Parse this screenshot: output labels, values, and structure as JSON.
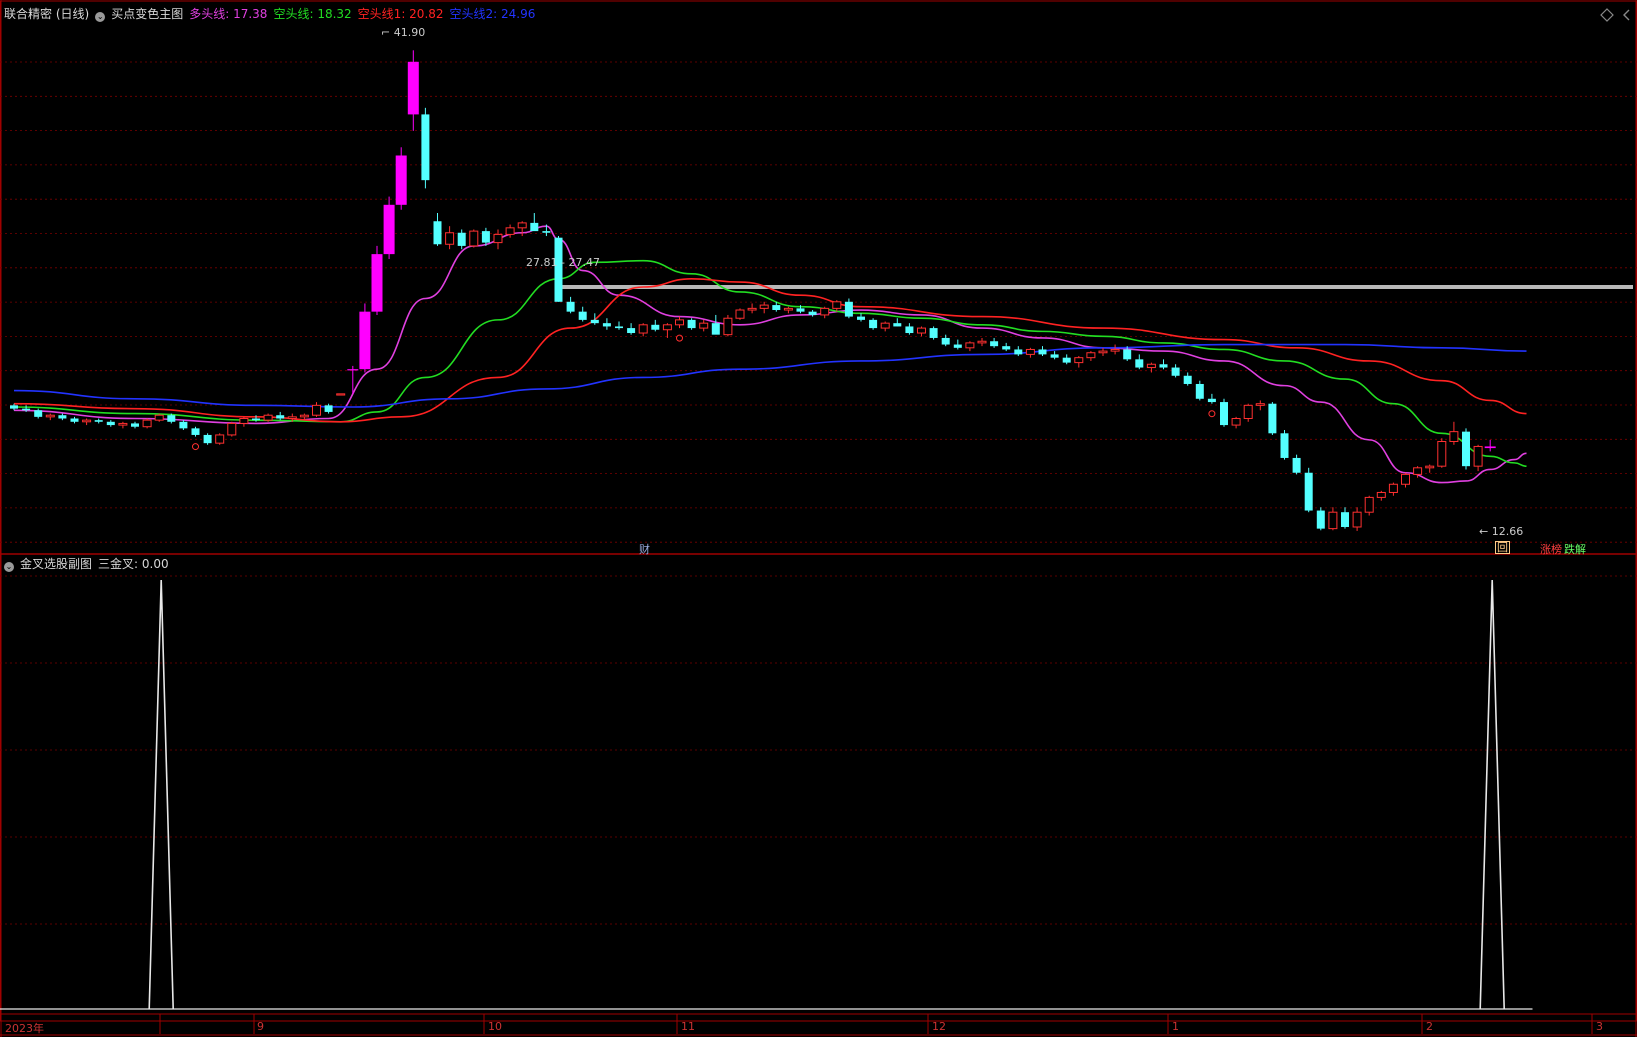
{
  "main_panel": {
    "title": "联合精密 (日线)",
    "indicator_name": "买点变色主图",
    "lines": [
      {
        "label": "多头线",
        "value": "17.38",
        "color": "#e040e0"
      },
      {
        "label": "空头线",
        "value": "18.32",
        "color": "#22dd22"
      },
      {
        "label": "空头线1",
        "value": "20.82",
        "color": "#ff2222"
      },
      {
        "label": "空头线2",
        "value": "24.96",
        "color": "#2233ff"
      }
    ],
    "annotations": {
      "high": "41.90",
      "low": "12.66",
      "range": "27.81 - 27.47",
      "tag_cai": "财",
      "tag_hui": "回",
      "tag_zhangbang": "涨榜",
      "tag_diejie": "跌解"
    }
  },
  "sub_panel": {
    "indicator_name": "金叉选股副图",
    "label": "三金叉",
    "value": "0.00"
  },
  "x_axis": {
    "labels": [
      "2023年",
      "9",
      "10",
      "11",
      "12",
      "1",
      "2",
      "3"
    ]
  },
  "colors": {
    "up": "#ff3030",
    "down": "#54ffff",
    "buy": "#ff00ff",
    "grid": "#7a0000",
    "border": "#a00000"
  },
  "chart_data": {
    "type": "candlestick",
    "price_range": [
      11.5,
      43.5
    ],
    "candles_ohlc": [
      [
        20.3,
        20.4,
        20.0,
        20.1
      ],
      [
        20.1,
        20.3,
        19.9,
        20.0
      ],
      [
        20.0,
        20.1,
        19.5,
        19.6
      ],
      [
        19.6,
        19.8,
        19.4,
        19.7
      ],
      [
        19.7,
        19.8,
        19.4,
        19.5
      ],
      [
        19.5,
        19.6,
        19.2,
        19.3
      ],
      [
        19.3,
        19.5,
        19.1,
        19.4
      ],
      [
        19.4,
        19.5,
        19.2,
        19.3
      ],
      [
        19.3,
        19.4,
        19.0,
        19.1
      ],
      [
        19.1,
        19.3,
        18.9,
        19.2
      ],
      [
        19.2,
        19.3,
        18.9,
        19.0
      ],
      [
        19.0,
        19.5,
        18.9,
        19.4
      ],
      [
        19.4,
        19.8,
        19.3,
        19.7
      ],
      [
        19.7,
        19.8,
        19.2,
        19.3
      ],
      [
        19.3,
        19.4,
        18.8,
        18.9
      ],
      [
        18.9,
        19.0,
        18.4,
        18.5
      ],
      [
        18.5,
        18.6,
        17.9,
        18.0
      ],
      [
        18.0,
        18.6,
        17.9,
        18.5
      ],
      [
        18.5,
        19.3,
        18.4,
        19.2
      ],
      [
        19.2,
        19.6,
        19.0,
        19.5
      ],
      [
        19.5,
        19.7,
        19.3,
        19.4
      ],
      [
        19.4,
        19.8,
        19.3,
        19.7
      ],
      [
        19.7,
        19.9,
        19.4,
        19.5
      ],
      [
        19.5,
        19.8,
        19.3,
        19.6
      ],
      [
        19.6,
        19.8,
        19.4,
        19.7
      ],
      [
        19.7,
        20.5,
        19.6,
        20.3
      ],
      [
        20.3,
        20.4,
        19.8,
        19.9
      ],
      [
        21.0,
        21.0,
        21.0,
        21.0
      ],
      [
        22.5,
        22.7,
        21.0,
        22.5
      ],
      [
        22.5,
        26.5,
        22.3,
        26.0
      ],
      [
        26.0,
        30.0,
        25.8,
        29.5
      ],
      [
        29.5,
        33.0,
        29.2,
        32.5
      ],
      [
        32.5,
        36.0,
        32.2,
        35.5
      ],
      [
        41.2,
        41.9,
        37.0,
        38.0
      ],
      [
        38.0,
        38.4,
        33.5,
        34.0
      ],
      [
        31.5,
        32.0,
        30.0,
        30.1
      ],
      [
        30.1,
        31.2,
        29.8,
        30.8
      ],
      [
        30.8,
        31.0,
        29.8,
        30.0
      ],
      [
        30.0,
        31.0,
        29.9,
        30.9
      ],
      [
        30.9,
        31.1,
        30.0,
        30.2
      ],
      [
        30.2,
        31.0,
        29.8,
        30.7
      ],
      [
        30.7,
        31.3,
        30.5,
        31.1
      ],
      [
        31.1,
        31.5,
        30.6,
        31.4
      ],
      [
        31.4,
        32.0,
        31.0,
        30.9
      ],
      [
        30.9,
        31.3,
        30.6,
        30.8
      ],
      [
        30.5,
        30.6,
        26.6,
        26.6
      ],
      [
        26.6,
        26.9,
        25.9,
        26.0
      ],
      [
        26.0,
        26.3,
        25.4,
        25.5
      ],
      [
        25.5,
        25.9,
        25.2,
        25.3
      ],
      [
        25.3,
        25.6,
        24.9,
        25.1
      ],
      [
        25.1,
        25.4,
        24.9,
        25.0
      ],
      [
        25.0,
        25.3,
        24.6,
        24.7
      ],
      [
        24.7,
        25.3,
        24.5,
        25.2
      ],
      [
        25.2,
        25.5,
        24.8,
        24.9
      ],
      [
        24.9,
        25.3,
        24.4,
        25.2
      ],
      [
        25.2,
        25.7,
        25.0,
        25.5
      ],
      [
        25.5,
        25.6,
        24.9,
        25.0
      ],
      [
        25.0,
        25.5,
        24.8,
        25.3
      ],
      [
        25.3,
        25.8,
        25.1,
        24.6
      ],
      [
        24.6,
        25.8,
        24.5,
        25.6
      ],
      [
        25.6,
        26.2,
        25.5,
        26.1
      ],
      [
        26.1,
        26.5,
        25.9,
        26.2
      ],
      [
        26.2,
        26.6,
        25.9,
        26.4
      ],
      [
        26.4,
        26.6,
        26.0,
        26.1
      ],
      [
        26.1,
        26.3,
        25.9,
        26.2
      ],
      [
        26.2,
        26.4,
        25.9,
        26.0
      ],
      [
        26.0,
        26.1,
        25.7,
        25.8
      ],
      [
        25.8,
        26.3,
        25.6,
        26.2
      ],
      [
        26.2,
        26.7,
        26.0,
        26.6
      ],
      [
        26.6,
        26.8,
        25.6,
        25.7
      ],
      [
        25.7,
        25.9,
        25.4,
        25.5
      ],
      [
        25.5,
        25.6,
        24.9,
        25.0
      ],
      [
        25.0,
        25.4,
        24.8,
        25.3
      ],
      [
        25.3,
        25.6,
        25.1,
        25.1
      ],
      [
        25.1,
        25.3,
        24.6,
        24.7
      ],
      [
        24.7,
        25.1,
        24.5,
        25.0
      ],
      [
        25.0,
        25.1,
        24.3,
        24.4
      ],
      [
        24.4,
        24.6,
        23.9,
        24.0
      ],
      [
        24.0,
        24.3,
        23.7,
        23.8
      ],
      [
        23.8,
        24.2,
        23.6,
        24.1
      ],
      [
        24.1,
        24.4,
        23.9,
        24.2
      ],
      [
        24.2,
        24.4,
        23.8,
        23.9
      ],
      [
        23.9,
        24.1,
        23.6,
        23.7
      ],
      [
        23.7,
        23.9,
        23.3,
        23.4
      ],
      [
        23.4,
        23.8,
        23.2,
        23.7
      ],
      [
        23.7,
        23.9,
        23.3,
        23.4
      ],
      [
        23.4,
        23.6,
        23.1,
        23.2
      ],
      [
        23.2,
        23.4,
        22.8,
        22.9
      ],
      [
        22.9,
        23.3,
        22.6,
        23.2
      ],
      [
        23.2,
        23.6,
        23.0,
        23.5
      ],
      [
        23.5,
        23.8,
        23.3,
        23.6
      ],
      [
        23.6,
        24.0,
        23.4,
        23.7
      ],
      [
        23.7,
        23.9,
        23.0,
        23.1
      ],
      [
        23.1,
        23.4,
        22.5,
        22.6
      ],
      [
        22.6,
        22.9,
        22.3,
        22.8
      ],
      [
        22.8,
        23.1,
        22.5,
        22.6
      ],
      [
        22.6,
        22.8,
        22.0,
        22.1
      ],
      [
        22.1,
        22.3,
        21.5,
        21.6
      ],
      [
        21.6,
        21.8,
        20.6,
        20.7
      ],
      [
        20.7,
        21.0,
        20.4,
        20.5
      ],
      [
        20.5,
        20.7,
        19.0,
        19.1
      ],
      [
        19.1,
        19.6,
        18.9,
        19.5
      ],
      [
        19.5,
        20.4,
        19.3,
        20.3
      ],
      [
        20.3,
        20.6,
        20.0,
        20.4
      ],
      [
        20.4,
        20.5,
        18.5,
        18.6
      ],
      [
        18.6,
        18.8,
        17.0,
        17.1
      ],
      [
        17.1,
        17.3,
        16.1,
        16.2
      ],
      [
        16.2,
        16.5,
        13.8,
        13.9
      ],
      [
        13.9,
        14.1,
        12.7,
        12.8
      ],
      [
        12.8,
        14.1,
        12.7,
        13.8
      ],
      [
        13.8,
        14.1,
        12.8,
        12.9
      ],
      [
        12.9,
        14.1,
        12.66,
        13.8
      ],
      [
        13.8,
        14.8,
        13.6,
        14.7
      ],
      [
        14.7,
        15.1,
        14.5,
        15.0
      ],
      [
        15.0,
        15.6,
        14.8,
        15.5
      ],
      [
        15.5,
        16.2,
        15.3,
        16.1
      ],
      [
        16.1,
        16.6,
        15.9,
        16.5
      ],
      [
        16.5,
        16.7,
        16.2,
        16.6
      ],
      [
        16.6,
        18.3,
        16.5,
        18.1
      ],
      [
        18.1,
        19.3,
        17.9,
        18.7
      ],
      [
        18.7,
        18.9,
        16.4,
        16.6
      ],
      [
        16.6,
        17.9,
        16.3,
        17.8
      ],
      [
        17.8,
        18.2,
        17.5,
        17.7
      ]
    ],
    "buy_signal_indices": [
      28,
      29,
      30,
      31,
      32,
      33,
      122
    ],
    "marker_indices": [
      15,
      55,
      99
    ],
    "hline_level": 27.5,
    "ma_lines": [
      {
        "name": "多头线",
        "color": "#e040e0",
        "points": [
          [
            0,
            20.0
          ],
          [
            10,
            19.5
          ],
          [
            20,
            19.2
          ],
          [
            26,
            19.5
          ],
          [
            30,
            22.5
          ],
          [
            34,
            26.8
          ],
          [
            38,
            30.0
          ],
          [
            42,
            30.8
          ],
          [
            44,
            31.2
          ],
          [
            45,
            30.4
          ],
          [
            47,
            28.5
          ],
          [
            50,
            27.0
          ],
          [
            55,
            25.7
          ],
          [
            60,
            25.2
          ],
          [
            65,
            25.8
          ],
          [
            70,
            26.1
          ],
          [
            75,
            25.8
          ],
          [
            80,
            25.0
          ],
          [
            85,
            24.4
          ],
          [
            90,
            23.8
          ],
          [
            95,
            23.6
          ],
          [
            100,
            23.0
          ],
          [
            105,
            21.5
          ],
          [
            108,
            20.5
          ],
          [
            112,
            18.2
          ],
          [
            115,
            16.2
          ],
          [
            118,
            15.6
          ],
          [
            120,
            15.7
          ],
          [
            122,
            16.4
          ],
          [
            124,
            17.0
          ],
          [
            125,
            17.38
          ]
        ]
      },
      {
        "name": "空头线",
        "color": "#22dd22",
        "points": [
          [
            0,
            20.2
          ],
          [
            10,
            19.8
          ],
          [
            20,
            19.4
          ],
          [
            27,
            19.3
          ],
          [
            30,
            19.9
          ],
          [
            34,
            22.0
          ],
          [
            40,
            25.5
          ],
          [
            45,
            28.0
          ],
          [
            48,
            29.0
          ],
          [
            52,
            29.1
          ],
          [
            56,
            28.3
          ],
          [
            60,
            27.2
          ],
          [
            65,
            26.3
          ],
          [
            70,
            25.9
          ],
          [
            75,
            25.6
          ],
          [
            80,
            25.2
          ],
          [
            85,
            24.8
          ],
          [
            90,
            24.5
          ],
          [
            95,
            24.1
          ],
          [
            100,
            23.7
          ],
          [
            105,
            23.0
          ],
          [
            110,
            21.9
          ],
          [
            114,
            20.4
          ],
          [
            118,
            18.6
          ],
          [
            122,
            17.2
          ],
          [
            124,
            16.8
          ],
          [
            125,
            16.6
          ]
        ]
      },
      {
        "name": "空头线1",
        "color": "#ff2222",
        "points": [
          [
            0,
            20.4
          ],
          [
            10,
            20.1
          ],
          [
            20,
            19.6
          ],
          [
            27,
            19.3
          ],
          [
            32,
            19.6
          ],
          [
            40,
            22.0
          ],
          [
            46,
            25.0
          ],
          [
            52,
            27.5
          ],
          [
            56,
            28.0
          ],
          [
            60,
            27.8
          ],
          [
            65,
            27.0
          ],
          [
            70,
            26.3
          ],
          [
            80,
            25.7
          ],
          [
            90,
            25.0
          ],
          [
            100,
            24.3
          ],
          [
            106,
            23.8
          ],
          [
            112,
            23.0
          ],
          [
            118,
            21.8
          ],
          [
            122,
            20.6
          ],
          [
            125,
            19.8
          ]
        ]
      },
      {
        "name": "空头线2",
        "color": "#2233ff",
        "points": [
          [
            0,
            21.2
          ],
          [
            10,
            20.7
          ],
          [
            20,
            20.3
          ],
          [
            28,
            20.2
          ],
          [
            36,
            20.7
          ],
          [
            44,
            21.3
          ],
          [
            52,
            22.0
          ],
          [
            60,
            22.5
          ],
          [
            70,
            23.0
          ],
          [
            80,
            23.4
          ],
          [
            90,
            23.8
          ],
          [
            100,
            24.0
          ],
          [
            110,
            24.0
          ],
          [
            118,
            23.8
          ],
          [
            125,
            23.6
          ]
        ]
      }
    ],
    "sub_panel_spikes": [
      {
        "index": 12,
        "value": 1
      },
      {
        "index": 122,
        "value": 1
      }
    ]
  }
}
